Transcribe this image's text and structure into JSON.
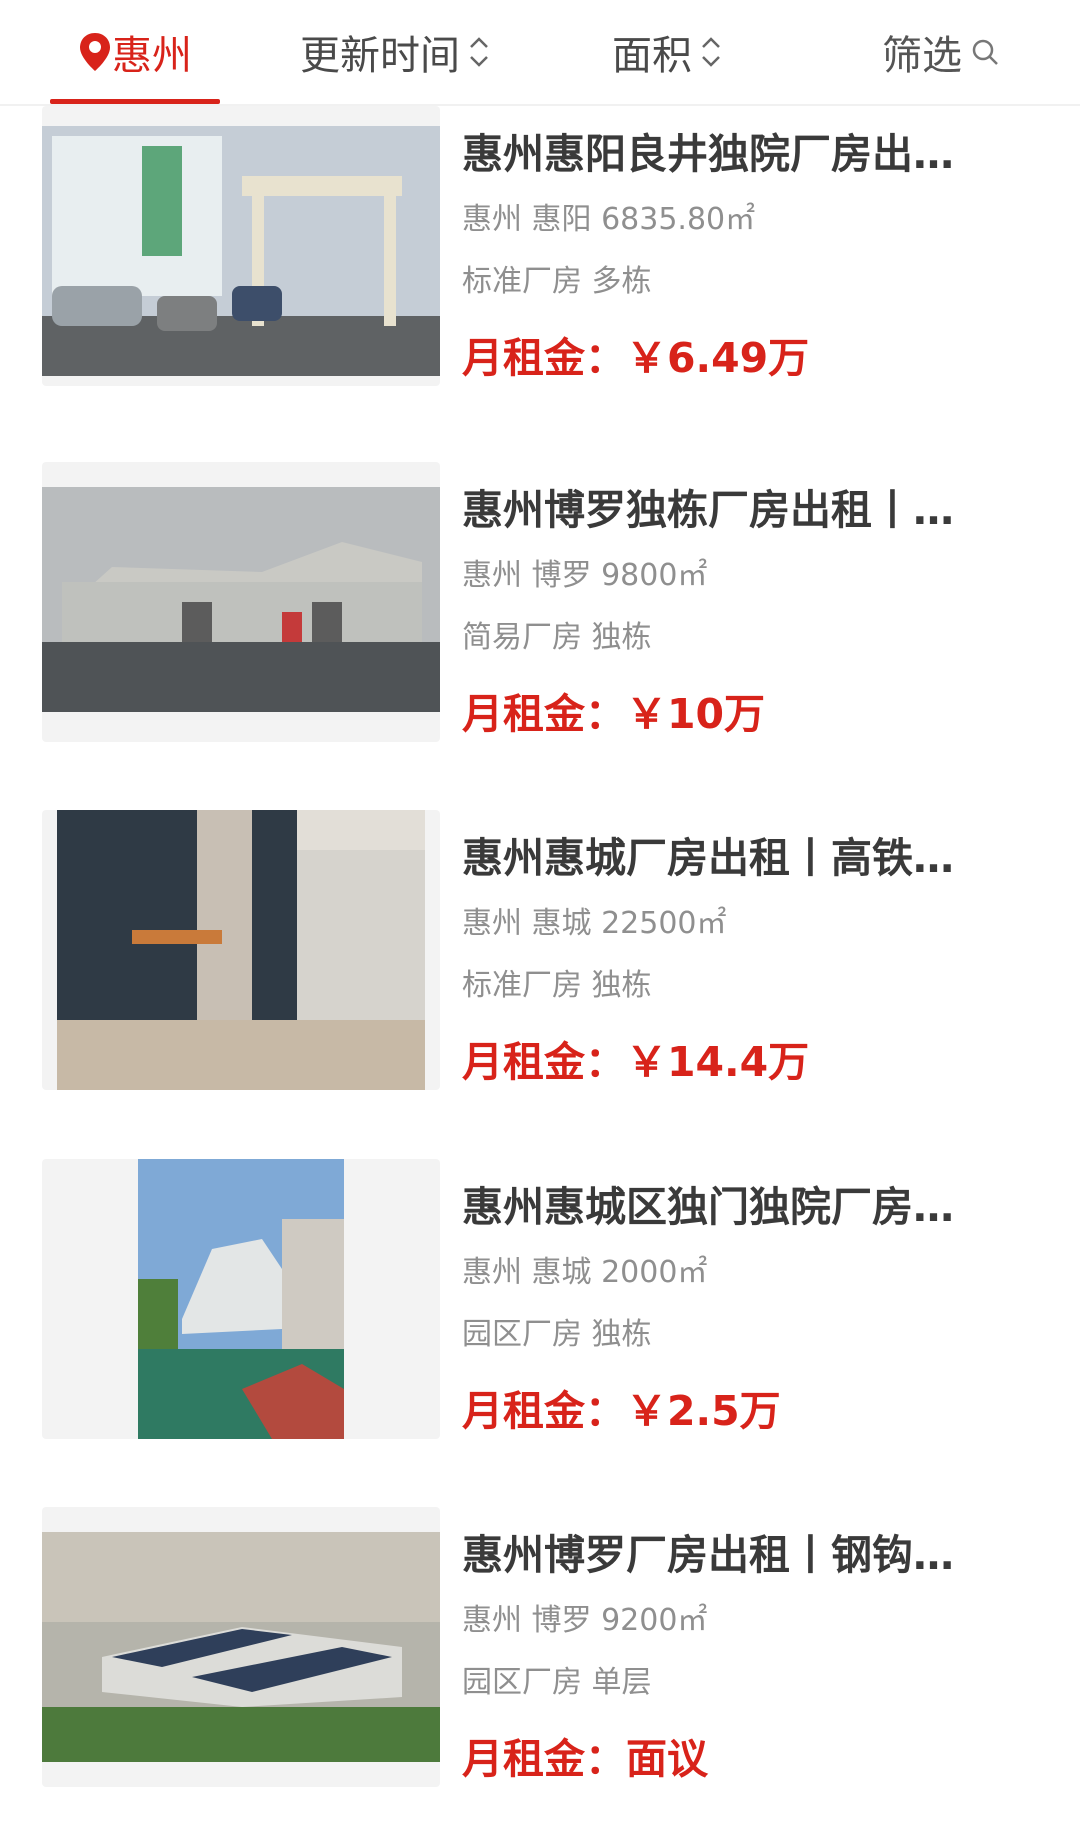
{
  "header": {
    "city": "惠州",
    "sort_update": "更新时间",
    "sort_area": "面积",
    "filter": "筛选"
  },
  "listings": [
    {
      "title": "惠州惠阳良井独院厂房出…",
      "location": "惠州 惠阳 6835.80㎡",
      "type": "标准厂房 多栋",
      "price_label": "月租金：",
      "price": "￥6.49万"
    },
    {
      "title": "惠州博罗独栋厂房出租丨…",
      "location": "惠州 博罗 9800㎡",
      "type": "简易厂房 独栋",
      "price_label": "月租金：",
      "price": "￥10万"
    },
    {
      "title": "惠州惠城厂房出租丨高铁…",
      "location": "惠州 惠城 22500㎡",
      "type": "标准厂房 独栋",
      "price_label": "月租金：",
      "price": "￥14.4万"
    },
    {
      "title": "惠州惠城区独门独院厂房…",
      "location": "惠州 惠城 2000㎡",
      "type": "园区厂房 独栋",
      "price_label": "月租金：",
      "price": "￥2.5万"
    },
    {
      "title": "惠州博罗厂房出租丨钢钩…",
      "location": "惠州 博罗 9200㎡",
      "type": "园区厂房 单层",
      "price_label": "月租金：",
      "price": "面议"
    }
  ],
  "colors": {
    "accent": "#d8231a",
    "title": "#3a3a3a",
    "meta": "#8f8f8f"
  }
}
